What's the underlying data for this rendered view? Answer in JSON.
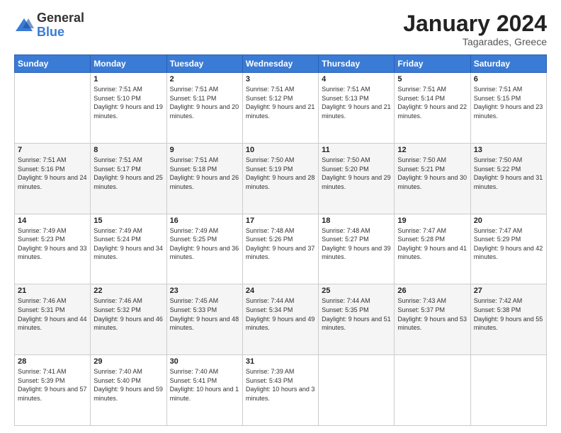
{
  "header": {
    "logo": {
      "general": "General",
      "blue": "Blue"
    },
    "month": "January 2024",
    "location": "Tagarades, Greece"
  },
  "weekdays": [
    "Sunday",
    "Monday",
    "Tuesday",
    "Wednesday",
    "Thursday",
    "Friday",
    "Saturday"
  ],
  "weeks": [
    [
      {
        "day": "",
        "sunrise": "",
        "sunset": "",
        "daylight": ""
      },
      {
        "day": "1",
        "sunrise": "Sunrise: 7:51 AM",
        "sunset": "Sunset: 5:10 PM",
        "daylight": "Daylight: 9 hours and 19 minutes."
      },
      {
        "day": "2",
        "sunrise": "Sunrise: 7:51 AM",
        "sunset": "Sunset: 5:11 PM",
        "daylight": "Daylight: 9 hours and 20 minutes."
      },
      {
        "day": "3",
        "sunrise": "Sunrise: 7:51 AM",
        "sunset": "Sunset: 5:12 PM",
        "daylight": "Daylight: 9 hours and 21 minutes."
      },
      {
        "day": "4",
        "sunrise": "Sunrise: 7:51 AM",
        "sunset": "Sunset: 5:13 PM",
        "daylight": "Daylight: 9 hours and 21 minutes."
      },
      {
        "day": "5",
        "sunrise": "Sunrise: 7:51 AM",
        "sunset": "Sunset: 5:14 PM",
        "daylight": "Daylight: 9 hours and 22 minutes."
      },
      {
        "day": "6",
        "sunrise": "Sunrise: 7:51 AM",
        "sunset": "Sunset: 5:15 PM",
        "daylight": "Daylight: 9 hours and 23 minutes."
      }
    ],
    [
      {
        "day": "7",
        "sunrise": "Sunrise: 7:51 AM",
        "sunset": "Sunset: 5:16 PM",
        "daylight": "Daylight: 9 hours and 24 minutes."
      },
      {
        "day": "8",
        "sunrise": "Sunrise: 7:51 AM",
        "sunset": "Sunset: 5:17 PM",
        "daylight": "Daylight: 9 hours and 25 minutes."
      },
      {
        "day": "9",
        "sunrise": "Sunrise: 7:51 AM",
        "sunset": "Sunset: 5:18 PM",
        "daylight": "Daylight: 9 hours and 26 minutes."
      },
      {
        "day": "10",
        "sunrise": "Sunrise: 7:50 AM",
        "sunset": "Sunset: 5:19 PM",
        "daylight": "Daylight: 9 hours and 28 minutes."
      },
      {
        "day": "11",
        "sunrise": "Sunrise: 7:50 AM",
        "sunset": "Sunset: 5:20 PM",
        "daylight": "Daylight: 9 hours and 29 minutes."
      },
      {
        "day": "12",
        "sunrise": "Sunrise: 7:50 AM",
        "sunset": "Sunset: 5:21 PM",
        "daylight": "Daylight: 9 hours and 30 minutes."
      },
      {
        "day": "13",
        "sunrise": "Sunrise: 7:50 AM",
        "sunset": "Sunset: 5:22 PM",
        "daylight": "Daylight: 9 hours and 31 minutes."
      }
    ],
    [
      {
        "day": "14",
        "sunrise": "Sunrise: 7:49 AM",
        "sunset": "Sunset: 5:23 PM",
        "daylight": "Daylight: 9 hours and 33 minutes."
      },
      {
        "day": "15",
        "sunrise": "Sunrise: 7:49 AM",
        "sunset": "Sunset: 5:24 PM",
        "daylight": "Daylight: 9 hours and 34 minutes."
      },
      {
        "day": "16",
        "sunrise": "Sunrise: 7:49 AM",
        "sunset": "Sunset: 5:25 PM",
        "daylight": "Daylight: 9 hours and 36 minutes."
      },
      {
        "day": "17",
        "sunrise": "Sunrise: 7:48 AM",
        "sunset": "Sunset: 5:26 PM",
        "daylight": "Daylight: 9 hours and 37 minutes."
      },
      {
        "day": "18",
        "sunrise": "Sunrise: 7:48 AM",
        "sunset": "Sunset: 5:27 PM",
        "daylight": "Daylight: 9 hours and 39 minutes."
      },
      {
        "day": "19",
        "sunrise": "Sunrise: 7:47 AM",
        "sunset": "Sunset: 5:28 PM",
        "daylight": "Daylight: 9 hours and 41 minutes."
      },
      {
        "day": "20",
        "sunrise": "Sunrise: 7:47 AM",
        "sunset": "Sunset: 5:29 PM",
        "daylight": "Daylight: 9 hours and 42 minutes."
      }
    ],
    [
      {
        "day": "21",
        "sunrise": "Sunrise: 7:46 AM",
        "sunset": "Sunset: 5:31 PM",
        "daylight": "Daylight: 9 hours and 44 minutes."
      },
      {
        "day": "22",
        "sunrise": "Sunrise: 7:46 AM",
        "sunset": "Sunset: 5:32 PM",
        "daylight": "Daylight: 9 hours and 46 minutes."
      },
      {
        "day": "23",
        "sunrise": "Sunrise: 7:45 AM",
        "sunset": "Sunset: 5:33 PM",
        "daylight": "Daylight: 9 hours and 48 minutes."
      },
      {
        "day": "24",
        "sunrise": "Sunrise: 7:44 AM",
        "sunset": "Sunset: 5:34 PM",
        "daylight": "Daylight: 9 hours and 49 minutes."
      },
      {
        "day": "25",
        "sunrise": "Sunrise: 7:44 AM",
        "sunset": "Sunset: 5:35 PM",
        "daylight": "Daylight: 9 hours and 51 minutes."
      },
      {
        "day": "26",
        "sunrise": "Sunrise: 7:43 AM",
        "sunset": "Sunset: 5:37 PM",
        "daylight": "Daylight: 9 hours and 53 minutes."
      },
      {
        "day": "27",
        "sunrise": "Sunrise: 7:42 AM",
        "sunset": "Sunset: 5:38 PM",
        "daylight": "Daylight: 9 hours and 55 minutes."
      }
    ],
    [
      {
        "day": "28",
        "sunrise": "Sunrise: 7:41 AM",
        "sunset": "Sunset: 5:39 PM",
        "daylight": "Daylight: 9 hours and 57 minutes."
      },
      {
        "day": "29",
        "sunrise": "Sunrise: 7:40 AM",
        "sunset": "Sunset: 5:40 PM",
        "daylight": "Daylight: 9 hours and 59 minutes."
      },
      {
        "day": "30",
        "sunrise": "Sunrise: 7:40 AM",
        "sunset": "Sunset: 5:41 PM",
        "daylight": "Daylight: 10 hours and 1 minute."
      },
      {
        "day": "31",
        "sunrise": "Sunrise: 7:39 AM",
        "sunset": "Sunset: 5:43 PM",
        "daylight": "Daylight: 10 hours and 3 minutes."
      },
      {
        "day": "",
        "sunrise": "",
        "sunset": "",
        "daylight": ""
      },
      {
        "day": "",
        "sunrise": "",
        "sunset": "",
        "daylight": ""
      },
      {
        "day": "",
        "sunrise": "",
        "sunset": "",
        "daylight": ""
      }
    ]
  ]
}
